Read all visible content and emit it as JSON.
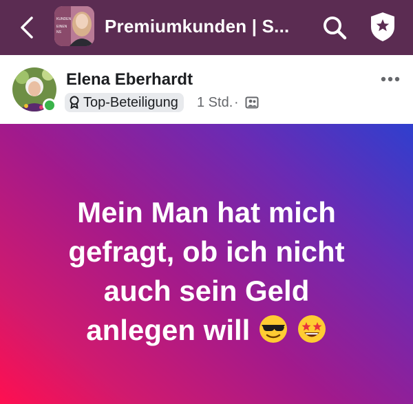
{
  "header": {
    "title": "Premiumkunden | S...",
    "thumb_text": [
      "KUNDEN",
      "EINEN",
      "NS"
    ]
  },
  "post": {
    "author": "Elena Eberhardt",
    "badge": "Top-Beteiligung",
    "time": "1 Std.",
    "separator": "·",
    "text_lines": [
      "Mein Man hat mich",
      "gefragt, ob ich nicht",
      "auch sein Geld",
      "anlegen will"
    ],
    "emojis": [
      "sunglasses-emoji",
      "star-struck-emoji"
    ]
  },
  "colors": {
    "header_bg": "#5b2c52",
    "online": "#3ab34a",
    "gradient": [
      "#ff0f50",
      "#a21a8c",
      "#2f3fce"
    ]
  }
}
